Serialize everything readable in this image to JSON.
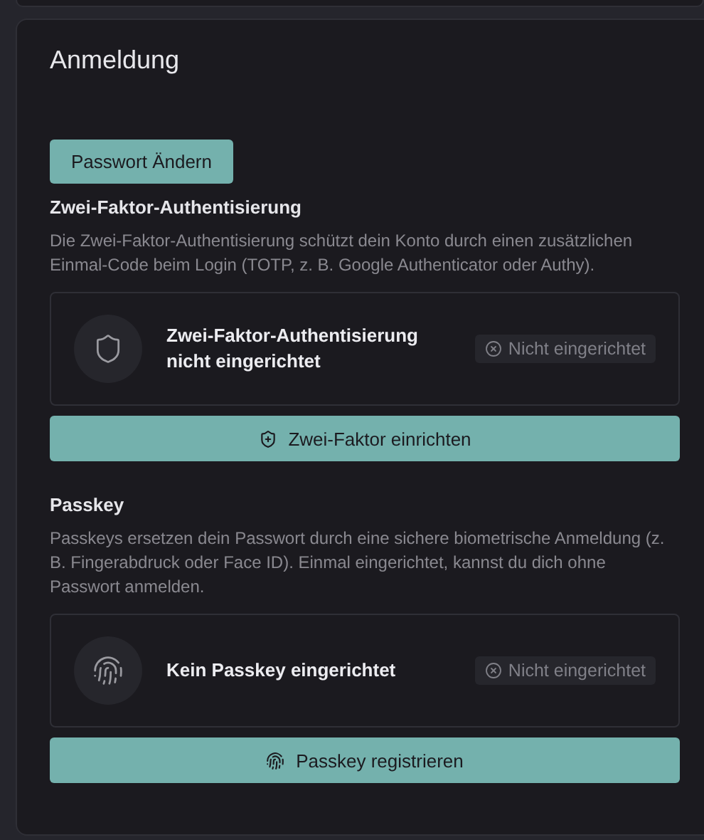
{
  "card": {
    "title": "Anmeldung",
    "change_password_button": "Passwort Ändern",
    "sections": [
      {
        "kind": "two-factor",
        "heading": "Zwei-Faktor-Authentisierung",
        "description": "Die Zwei-Faktor-Authentisierung schützt dein Konto durch einen zusätzlichen Einmal-Code beim Login (TOTP, z. B. Google Authenticator oder Authy).",
        "status_text": "Zwei-Faktor-Authentisierung nicht eingerichtet",
        "configured": false,
        "badge": "Nicht eingerichtet",
        "action": "Zwei-Faktor einrichten"
      },
      {
        "kind": "passkey",
        "heading": "Passkey",
        "description": "Passkeys ersetzen dein Passwort durch eine sichere biometrische Anmeldung (z. B. Fingerabdruck oder Face ID). Einmal eingerichtet, kannst du dich ohne Passwort anmelden.",
        "status_text": "Kein Passkey eingerichtet",
        "configured": false,
        "badge": "Nicht eingerichtet",
        "action": "Passkey registrieren"
      }
    ]
  }
}
